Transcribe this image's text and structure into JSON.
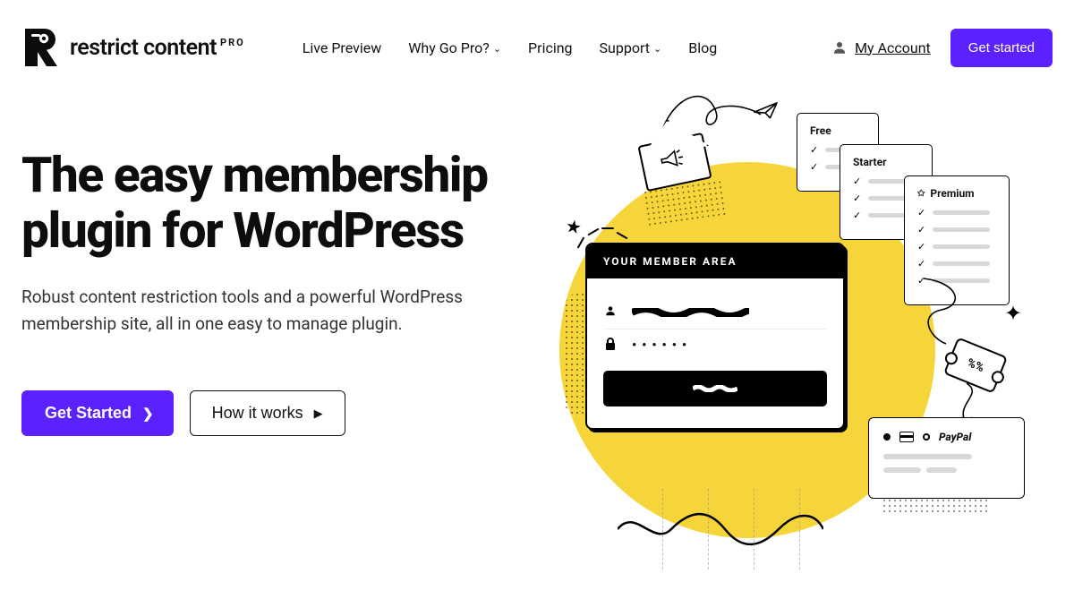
{
  "brand": {
    "name": "restrict content",
    "suffix": "PRO"
  },
  "nav": {
    "items": [
      {
        "label": "Live Preview",
        "hasDropdown": false
      },
      {
        "label": "Why Go Pro?",
        "hasDropdown": true
      },
      {
        "label": "Pricing",
        "hasDropdown": false
      },
      {
        "label": "Support",
        "hasDropdown": true
      },
      {
        "label": "Blog",
        "hasDropdown": false
      }
    ]
  },
  "header": {
    "account_label": "My Account",
    "cta_label": "Get started"
  },
  "hero": {
    "title": "The easy membership plugin for WordPress",
    "subtitle": "Robust content restriction tools and a powerful WordPress membership site, all in one easy to manage plugin.",
    "primary_cta": "Get Started",
    "secondary_cta": "How it works"
  },
  "graphic": {
    "member_area_title": "YOUR MEMBER AREA",
    "plans": {
      "free": "Free",
      "starter": "Starter",
      "premium": "Premium"
    },
    "coupon_text": "%%",
    "paypal_label": "PayPal"
  },
  "colors": {
    "primary": "#5b21ff",
    "accent_yellow": "#f5d539"
  }
}
